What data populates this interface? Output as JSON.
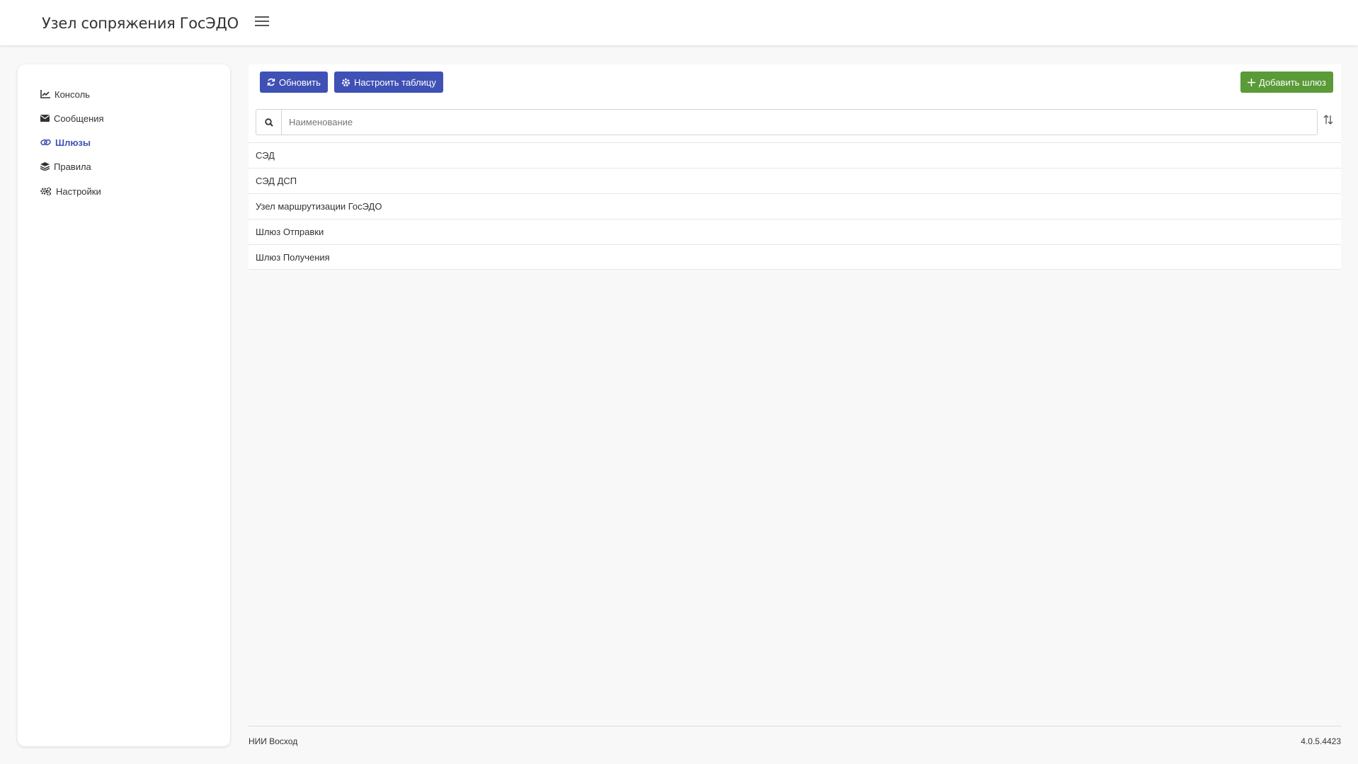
{
  "header": {
    "title": "Узел сопряжения ГосЭДО"
  },
  "sidebar": {
    "items": [
      {
        "label": "Консоль",
        "icon": "line-chart-icon"
      },
      {
        "label": "Сообщения",
        "icon": "envelope-icon"
      },
      {
        "label": "Шлюзы",
        "icon": "link-icon",
        "active": true
      },
      {
        "label": "Правила",
        "icon": "layers-icon"
      },
      {
        "label": "Настройки",
        "icon": "cogs-icon"
      }
    ]
  },
  "toolbar": {
    "refresh_label": "Обновить",
    "configure_table_label": "Настроить таблицу",
    "add_gateway_label": "Добавить шлюз"
  },
  "search": {
    "placeholder": "Наименование",
    "value": ""
  },
  "gateways": [
    "СЭД",
    "СЭД ДСП",
    "Узел маршрутизации ГосЭДО",
    "Шлюз Отправки",
    "Шлюз Получения"
  ],
  "footer": {
    "org": "НИИ Восход",
    "version": "4.0.5.4423"
  },
  "colors": {
    "primary": "#3f51b5",
    "success": "#5a9a37"
  }
}
